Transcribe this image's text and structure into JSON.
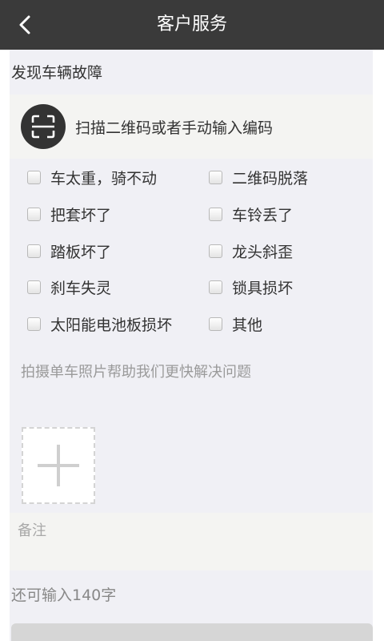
{
  "header": {
    "title": "客户服务",
    "back_icon": "chevron-left-icon"
  },
  "fault_section": {
    "title": "发现车辆故障",
    "scan": {
      "icon": "qr-scan-icon",
      "label": "扫描二维码或者手动输入编码"
    },
    "options": [
      {
        "label": "车太重，骑不动",
        "checked": false
      },
      {
        "label": "二维码脱落",
        "checked": false
      },
      {
        "label": "把套坏了",
        "checked": false
      },
      {
        "label": "车铃丢了",
        "checked": false
      },
      {
        "label": "踏板坏了",
        "checked": false
      },
      {
        "label": "龙头斜歪",
        "checked": false
      },
      {
        "label": "刹车失灵",
        "checked": false
      },
      {
        "label": "锁具损坏",
        "checked": false
      },
      {
        "label": "太阳能电池板损坏",
        "checked": false
      },
      {
        "label": "其他",
        "checked": false
      }
    ]
  },
  "photo": {
    "hint": "拍摄单车照片帮助我们更快解决问题",
    "add_icon": "plus-icon"
  },
  "remark": {
    "placeholder": "备注",
    "value": "",
    "char_count": "还可输入140字"
  },
  "colors": {
    "header_bg": "#3a3a3a",
    "content_bg": "#f0f0f5",
    "scan_icon_bg": "#333333",
    "submit_bg": "#d6d6d6"
  }
}
